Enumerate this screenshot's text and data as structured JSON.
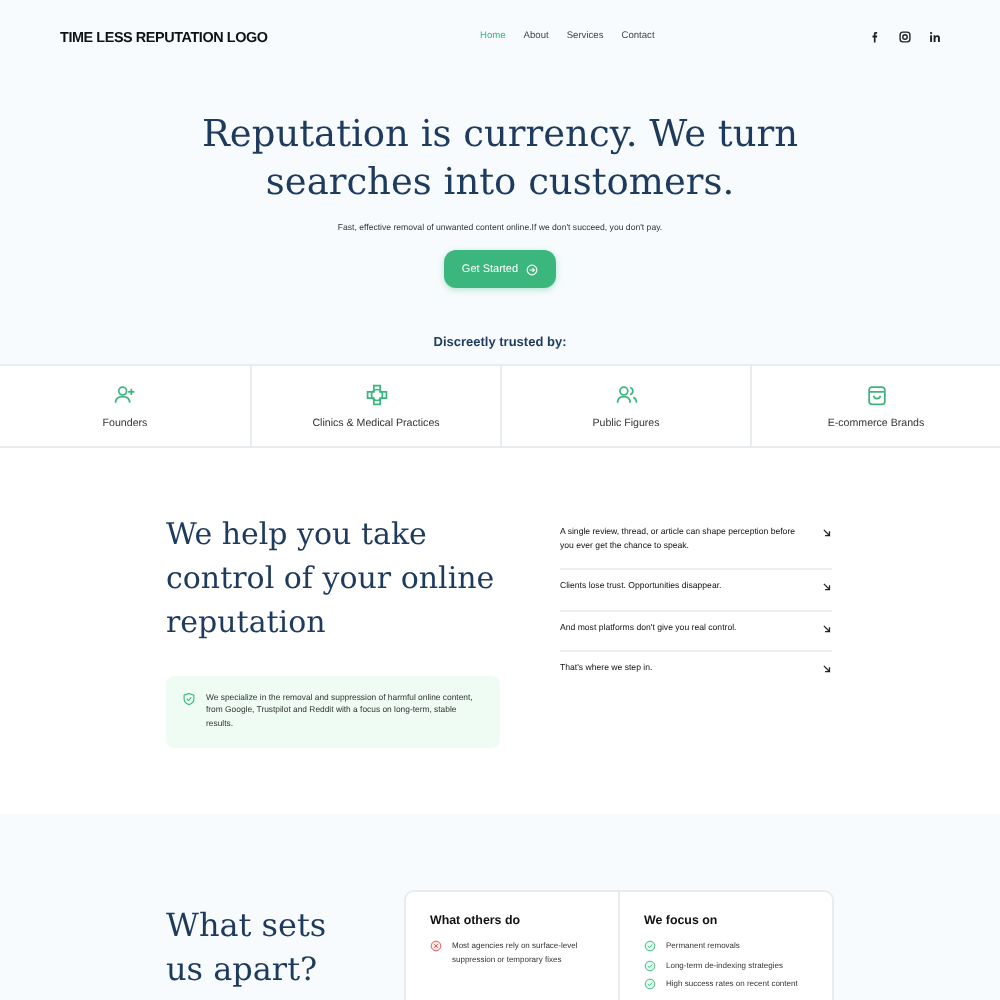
{
  "header": {
    "logo": "TIME LESS REPUTATION LOGO",
    "nav": [
      {
        "label": "Home",
        "selected": true
      },
      {
        "label": "About",
        "selected": false
      },
      {
        "label": "Services",
        "selected": false
      },
      {
        "label": "Contact",
        "selected": false
      }
    ],
    "social": [
      {
        "kind": "facebook"
      },
      {
        "kind": "instagram"
      },
      {
        "kind": "linkedin"
      }
    ]
  },
  "hero": {
    "title": "Reputation is currency. We turn searches into customers.",
    "subtitle": "Fast, effective removal of unwanted content online.If we don't succeed, you don't pay.",
    "button": "Get Started"
  },
  "trusted": {
    "heading": "Discreetly trusted by:",
    "items": [
      {
        "kind": "person-add",
        "label": "Founders"
      },
      {
        "kind": "cross",
        "label": "Clinics & Medical Practices"
      },
      {
        "kind": "people",
        "label": "Public Figures"
      },
      {
        "kind": "bag",
        "label": "E-commerce Brands"
      }
    ]
  },
  "control": {
    "heading": "We help you take control of your online reputation",
    "note": "We specialize in the removal and suppression of harmful online content, from Google, Trustpilot and Reddit with a focus on long-term, stable results.",
    "points": [
      "A single review, thread, or article can shape perception before you ever get the chance to speak.",
      "Clients lose trust. Opportunities disappear.",
      "And most platforms don't give you real control.",
      "That's where we step in."
    ]
  },
  "apart": {
    "heading": "What sets us apart?",
    "columns": [
      {
        "title": "What others do",
        "items": [
          {
            "kind": "cross",
            "text": "Most agencies rely on surface-level suppression or temporary fixes"
          }
        ]
      },
      {
        "title": "We focus on",
        "items": [
          {
            "kind": "check",
            "text": "Permanent removals"
          },
          {
            "kind": "check",
            "text": "Long-term de-indexing strategies"
          },
          {
            "kind": "check",
            "text": "High success rates on recent content"
          }
        ]
      }
    ]
  }
}
